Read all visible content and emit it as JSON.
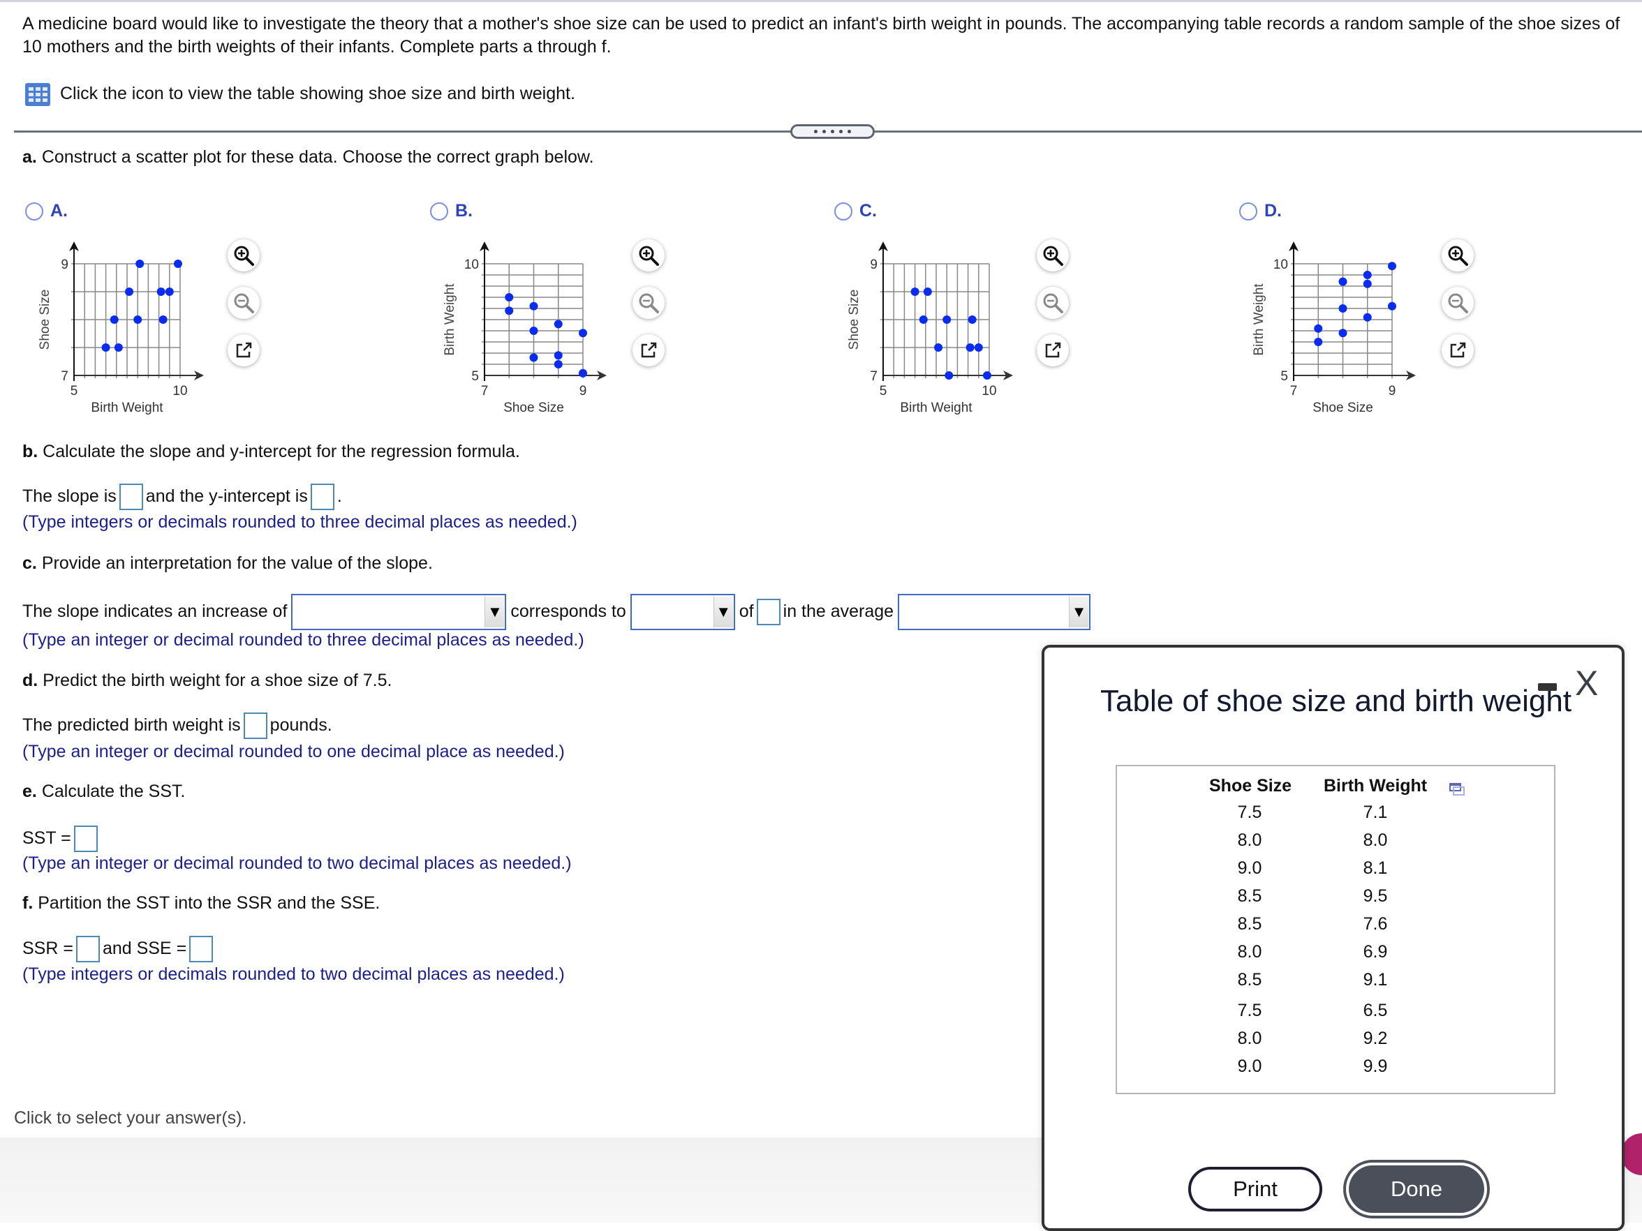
{
  "intro": {
    "text": "A medicine board would like to investigate the theory that a mother's shoe size can be used to predict an infant's birth weight in pounds. The accompanying table records a random sample of the shoe sizes of 10 mothers and the birth weights of their infants. Complete parts a through f.",
    "table_link": "Click the icon to view the table showing shoe size and birth weight."
  },
  "part_a": {
    "label": "a.",
    "text": "Construct a scatter plot for these data. Choose the correct graph below.",
    "options": [
      {
        "letter": "A.",
        "selected": false
      },
      {
        "letter": "B.",
        "selected": false
      },
      {
        "letter": "C.",
        "selected": false
      },
      {
        "letter": "D.",
        "selected": false
      }
    ]
  },
  "chart_data": [
    {
      "type": "scatter",
      "option": "A",
      "xlabel": "Birth Weight",
      "ylabel": "Shoe Size",
      "xlim": [
        5,
        10
      ],
      "ylim": [
        7,
        9
      ],
      "x_ticks": [
        "5",
        "10"
      ],
      "y_ticks": [
        "7",
        "9"
      ],
      "x_grid_step": 0.5,
      "y_grid_step": 0.5,
      "grid": true,
      "points": [
        [
          8.1,
          9.0
        ],
        [
          9.9,
          9.0
        ],
        [
          7.6,
          8.5
        ],
        [
          9.1,
          8.5
        ],
        [
          9.5,
          8.5
        ],
        [
          6.9,
          8.0
        ],
        [
          8.0,
          8.0
        ],
        [
          9.2,
          8.0
        ],
        [
          6.5,
          7.5
        ],
        [
          7.1,
          7.5
        ]
      ]
    },
    {
      "type": "scatter",
      "option": "B",
      "xlabel": "Shoe Size",
      "ylabel": "Birth Weight",
      "xlim": [
        7,
        9
      ],
      "ylim": [
        5,
        10
      ],
      "x_ticks": [
        "7",
        "9"
      ],
      "y_ticks": [
        "5",
        "10"
      ],
      "x_grid_step": 0.5,
      "y_grid_step": 0.5,
      "grid": true,
      "points": [
        [
          7.5,
          8.5
        ],
        [
          7.5,
          7.9
        ],
        [
          8.0,
          8.1
        ],
        [
          8.0,
          7.0
        ],
        [
          8.0,
          5.8
        ],
        [
          8.5,
          7.3
        ],
        [
          8.5,
          5.9
        ],
        [
          8.5,
          5.5
        ],
        [
          9.0,
          6.9
        ],
        [
          9.0,
          5.1
        ]
      ]
    },
    {
      "type": "scatter",
      "option": "C",
      "xlabel": "Birth Weight",
      "ylabel": "Shoe Size",
      "xlim": [
        5,
        10
      ],
      "ylim": [
        7,
        9
      ],
      "x_ticks": [
        "5",
        "10"
      ],
      "y_ticks": [
        "7",
        "9"
      ],
      "x_grid_step": 0.5,
      "y_grid_step": 0.5,
      "grid": true,
      "points": [
        [
          6.5,
          8.5
        ],
        [
          7.1,
          8.5
        ],
        [
          6.9,
          8.0
        ],
        [
          8.0,
          8.0
        ],
        [
          9.2,
          8.0
        ],
        [
          7.6,
          7.5
        ],
        [
          9.1,
          7.5
        ],
        [
          9.5,
          7.5
        ],
        [
          8.1,
          7.0
        ],
        [
          9.9,
          7.0
        ]
      ]
    },
    {
      "type": "scatter",
      "option": "D",
      "xlabel": "Shoe Size",
      "ylabel": "Birth Weight",
      "xlim": [
        7,
        9
      ],
      "ylim": [
        5,
        10
      ],
      "x_ticks": [
        "7",
        "9"
      ],
      "y_ticks": [
        "5",
        "10"
      ],
      "x_grid_step": 0.5,
      "y_grid_step": 0.5,
      "grid": true,
      "points": [
        [
          7.5,
          7.1
        ],
        [
          8.0,
          8.0
        ],
        [
          9.0,
          8.1
        ],
        [
          8.5,
          9.5
        ],
        [
          8.5,
          7.6
        ],
        [
          8.0,
          6.9
        ],
        [
          8.5,
          9.1
        ],
        [
          7.5,
          6.5
        ],
        [
          8.0,
          9.2
        ],
        [
          9.0,
          9.9
        ]
      ]
    }
  ],
  "part_b": {
    "label": "b.",
    "text": "Calculate the slope and y-intercept for the regression formula.",
    "sentence_1": "The slope is",
    "sentence_2": "and the y-intercept is",
    "sentence_end": ".",
    "slope_value": "",
    "intercept_value": "",
    "hint": "(Type integers or decimals rounded to three decimal places as needed.)"
  },
  "part_c": {
    "label": "c.",
    "text": "Provide an interpretation for the value of the slope.",
    "s1": "The slope indicates an increase of",
    "s2": "corresponds to",
    "s3": "of",
    "s4": "in the average",
    "dropdown_1": "",
    "dropdown_2": "",
    "value": "",
    "dropdown_3": "",
    "hint": "(Type an integer or decimal rounded to three decimal places as needed.)"
  },
  "part_d": {
    "label": "d.",
    "text": "Predict the birth weight for a shoe size of 7.5.",
    "s1": "The predicted birth weight is",
    "s2": "pounds.",
    "value": "",
    "hint": "(Type an integer or decimal rounded to one decimal place as needed.)"
  },
  "part_e": {
    "label": "e.",
    "text": "Calculate the SST.",
    "s1": "SST =",
    "value": "",
    "hint": "(Type an integer or decimal rounded to two decimal places as needed.)"
  },
  "part_f": {
    "label": "f.",
    "text": "Partition the SST into the SSR and the SSE.",
    "s1": "SSR =",
    "s2": "and SSE =",
    "ssr_value": "",
    "sse_value": "",
    "hint": "(Type integers or decimals rounded to two decimal places as needed.)"
  },
  "status": "Click to select your answer(s).",
  "dialog": {
    "title": "Table of shoe size and birth weight",
    "close_glyph": "X",
    "columns": [
      "Shoe Size",
      "Birth Weight"
    ],
    "rows": [
      [
        "7.5",
        "7.1"
      ],
      [
        "8.0",
        "8.0"
      ],
      [
        "9.0",
        "8.1"
      ],
      [
        "8.5",
        "9.5"
      ],
      [
        "8.5",
        "7.6"
      ],
      [
        "8.0",
        "6.9"
      ],
      [
        "8.5",
        "9.1"
      ],
      [
        "7.5",
        "6.5"
      ],
      [
        "8.0",
        "9.2"
      ],
      [
        "9.0",
        "9.9"
      ]
    ],
    "print_label": "Print",
    "done_label": "Done"
  },
  "colors": {
    "accent_blue": "#2d43b8",
    "hint_blue": "#1a1f8c",
    "point_blue": "#0a2cf0",
    "done_button": "#4a4f59"
  }
}
